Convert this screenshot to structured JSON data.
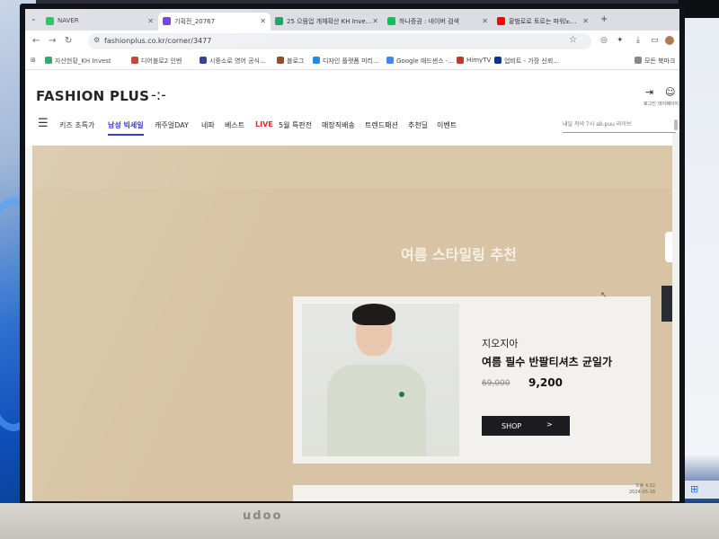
{
  "tabs": [
    {
      "title": "NAVER",
      "favicon_color": "#03c75a",
      "active": false
    },
    {
      "title": "기획전_20767",
      "favicon_color": "#6a3bd6",
      "active": true
    },
    {
      "title": "25 으뜸업 개체확산 KH Inve...",
      "favicon_color": "#1aa260",
      "active": false
    },
    {
      "title": "하나증권 : 네이버 검색",
      "favicon_color": "#03c75a",
      "active": false
    },
    {
      "title": "황범로로 토르는 파워노...",
      "favicon_color": "#ff0000",
      "active": false
    }
  ],
  "browser": {
    "url": "fashionplus.co.kr/corner/3477",
    "back_icon": "←",
    "forward_icon": "→",
    "reload_icon": "↻",
    "new_tab": "+"
  },
  "bookmarks": [
    {
      "label": "자산현황_KH Invest",
      "color": "#1aa260"
    },
    {
      "label": "디어블로2 인벤",
      "color": "#c0392b"
    },
    {
      "label": "시중소로 영어 공식...",
      "color": "#2b3a8f"
    },
    {
      "label": "블로그",
      "color": "#8e4a2b"
    },
    {
      "label": "디자인 플랫폼 미리...",
      "color": "#1e88e5"
    },
    {
      "label": "Google 애드센스 -...",
      "color": "#4285f4"
    },
    {
      "label": "HimyTV",
      "color": "#c0392b"
    },
    {
      "label": "업비트 - 가장 신뢰...",
      "color": "#093687"
    },
    {
      "label": "모든 북마크",
      "color": "#888888"
    }
  ],
  "site": {
    "logo": "FASHION PLUS",
    "logo_mark": "-:-",
    "login_label": "로그인",
    "mypage_label": "마이페이지",
    "search_placeholder": "내일 저녁 7시 ab.puu 라이브"
  },
  "gnb": [
    {
      "label": "키즈 초특가",
      "state": "normal"
    },
    {
      "label": "남성 빅세일",
      "state": "active"
    },
    {
      "label": "캐주얼DAY",
      "state": "normal"
    },
    {
      "label": "네파",
      "state": "normal"
    },
    {
      "label": "베스트",
      "state": "normal"
    },
    {
      "label": "LIVE",
      "state": "live"
    },
    {
      "label": "5월 특판전",
      "state": "normal"
    },
    {
      "label": "매장직배송",
      "state": "normal"
    },
    {
      "label": "트렌드패션",
      "state": "normal"
    },
    {
      "label": "추천딜",
      "state": "normal"
    },
    {
      "label": "이벤트",
      "state": "normal"
    }
  ],
  "promo": {
    "title": "여름 스타일링 추천",
    "brand": "지오지아",
    "product": "여름 필수 반팔티셔츠 균일가",
    "original_price": "69,000",
    "sale_price": "9,200",
    "cta": "SHOP",
    "cta_arrow": ">"
  },
  "taskbar": {
    "time": "오후 4:32",
    "date": "2024-05-18"
  },
  "monitor_brand": "udoo"
}
